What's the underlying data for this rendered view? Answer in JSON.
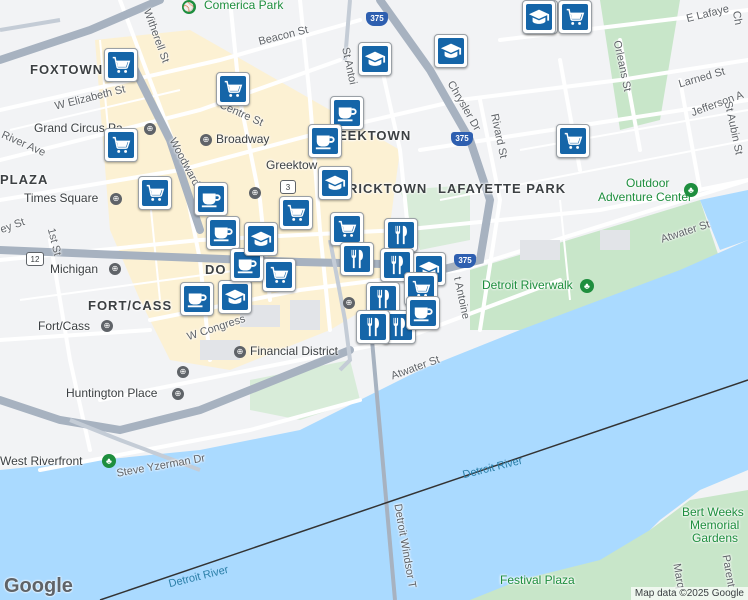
{
  "map": {
    "labels": {
      "foxtown": "FOXTOWN",
      "greektown": "GREEKTOWN",
      "greektown_partial": "EEKTOWN",
      "bricktown": "BRICKTOWN",
      "bricktown_partial": "RICKTOWN",
      "lafayette_park": "LAFAYETTE PARK",
      "fort_cass": "FORT/CASS",
      "plaza": "PLAZA",
      "downtown_partial": "DO",
      "comerica_park": "Comerica Park",
      "grand_circus": "Grand Circus Pa",
      "broadway": "Broadway",
      "greektown_station": "Greektow",
      "times_square": "Times Square",
      "michigan": "Michigan",
      "fort_cass_station": "Fort/Cass",
      "financial_district": "Financial District",
      "huntington_place": "Huntington Place",
      "west_riverfront": "West Riverfront",
      "detroit_riverwalk": "Detroit Riverwalk",
      "outdoor_adventure_1": "Outdoor",
      "outdoor_adventure_2": "Adventure Center",
      "bert_weeks_1": "Bert Weeks",
      "bert_weeks_2": "Memorial",
      "bert_weeks_3": "Gardens",
      "festival_plaza": "Festival Plaza",
      "detroit_river_1": "Detroit River",
      "detroit_river_2": "Detroit River",
      "detroit_windsor": "Detroit Windsor T"
    },
    "streets": {
      "witherell": "Witherell St",
      "beacon": "Beacon St",
      "w_elizabeth": "W Elizabeth St",
      "centre": "Centre St",
      "woodward": "Woodward",
      "river_ave": "River Ave",
      "ey_st": "ey St",
      "first_st": "1st St",
      "w_congress": "W Congress",
      "st_antoine_n": "St Antoi",
      "st_antoine_s": "t Antoine",
      "chrysler": "Chrysler Dr",
      "rivard": "Rivard St",
      "orleans": "Orleans St",
      "e_lafayette": "E Lafaye",
      "larned": "Larned St",
      "jefferson": "Jefferson A",
      "st_aubin": "St Aubin St",
      "atwater_e": "Atwater St",
      "atwater_w": "Atwater St",
      "steve_yzerman": "Steve Yzerman Dr",
      "marq": "Marq",
      "parent": "Parent",
      "ch_partial": "Ch"
    },
    "shields": {
      "i375_top": "375",
      "i375_mid": "375",
      "i375_low": "375",
      "m3": "3",
      "m12": "12"
    },
    "attribution": "Map data ©2025 Google",
    "logo": "Google"
  },
  "markers": [
    {
      "type": "shopping",
      "icon": "cart-icon"
    },
    {
      "type": "education",
      "icon": "graduation-cap-icon"
    },
    {
      "type": "cafe",
      "icon": "coffee-cup-icon"
    },
    {
      "type": "restaurant",
      "icon": "fork-knife-icon"
    }
  ],
  "colors": {
    "water": "#aadaff",
    "park": "#c8e6c9",
    "highway": "#a7b2c0",
    "marker": "#1565a8",
    "downtown": "#fdf1cf"
  }
}
